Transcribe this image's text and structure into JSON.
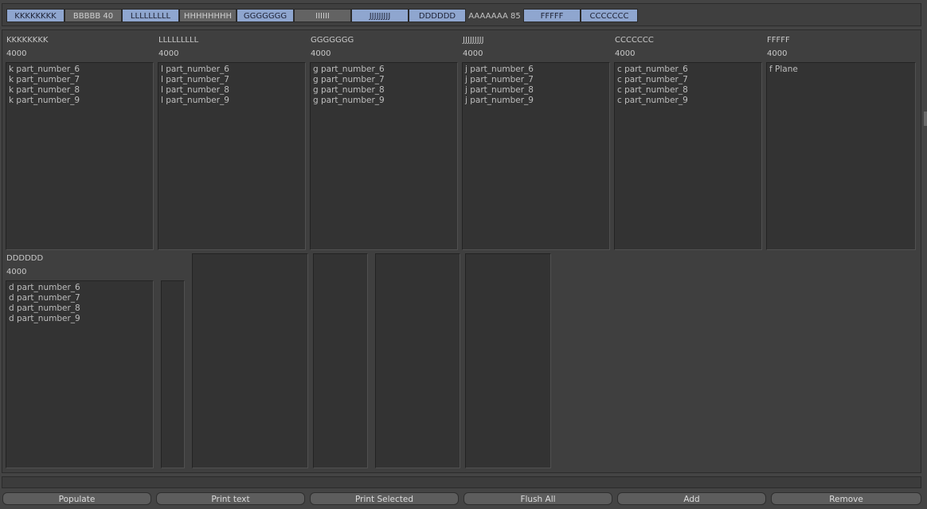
{
  "tabs": [
    {
      "label": "KKKKKKKK",
      "state": "on"
    },
    {
      "label": "BBBBB 40",
      "state": "off"
    },
    {
      "label": "LLLLLLLLL",
      "state": "on"
    },
    {
      "label": "HHHHHHHH",
      "state": "off"
    },
    {
      "label": "GGGGGGG",
      "state": "on"
    },
    {
      "label": "IIIIII",
      "state": "off"
    },
    {
      "label": "JJJJJJJJJ",
      "state": "on"
    },
    {
      "label": "DDDDDD",
      "state": "on"
    },
    {
      "label": "AAAAAAA 85",
      "state": "plain"
    },
    {
      "label": "FFFFF",
      "state": "on"
    },
    {
      "label": "CCCCCCC",
      "state": "on"
    }
  ],
  "columns": [
    {
      "title": "KKKKKKKK",
      "count": "4000",
      "items": [
        "k part_number_6",
        "k part_number_7",
        "k part_number_8",
        "k part_number_9"
      ]
    },
    {
      "title": "LLLLLLLLL",
      "count": "4000",
      "items": [
        "l part_number_6",
        "l part_number_7",
        "l part_number_8",
        "l part_number_9"
      ]
    },
    {
      "title": "GGGGGGG",
      "count": "4000",
      "items": [
        "g part_number_6",
        "g part_number_7",
        "g part_number_8",
        "g part_number_9"
      ]
    },
    {
      "title": "JJJJJJJJJ",
      "count": "4000",
      "items": [
        "j part_number_6",
        "j part_number_7",
        "j part_number_8",
        "j part_number_9"
      ]
    },
    {
      "title": "CCCCCCC",
      "count": "4000",
      "items": [
        "c part_number_6",
        "c part_number_7",
        "c part_number_8",
        "c part_number_9"
      ]
    },
    {
      "title": "FFFFF",
      "count": "4000",
      "items": [
        "f Plane"
      ]
    },
    {
      "title": "DDDDDD",
      "count": "4000",
      "items": [
        "d part_number_6",
        "d part_number_7",
        "d part_number_8",
        "d part_number_9"
      ]
    }
  ],
  "buttons": {
    "populate": "Populate",
    "print_text": "Print text",
    "print_selected": "Print Selected",
    "flush_all": "Flush All",
    "add": "Add",
    "remove": "Remove"
  }
}
